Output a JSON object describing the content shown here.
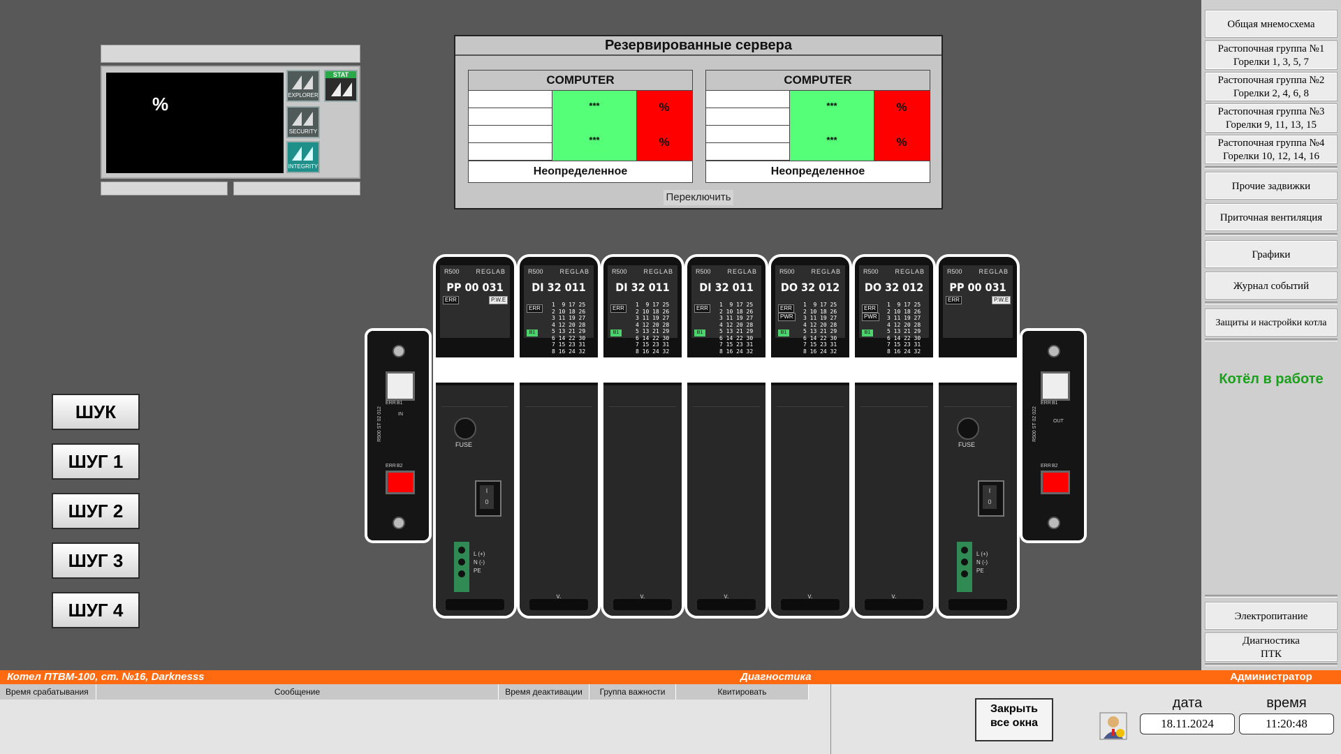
{
  "workstation": {
    "percent_label": "%",
    "buttons": [
      {
        "label": "EXPLORER",
        "icon": "explorer-icon"
      },
      {
        "label": "SECURITY",
        "icon": "security-icon"
      },
      {
        "label": "INTEGRITY",
        "icon": "integrity-icon"
      }
    ],
    "stat_label": "STAT"
  },
  "servers": {
    "title": "Резервированные сервера",
    "computers": [
      {
        "header": "COMPUTER",
        "value1": "***",
        "value2": "***",
        "pct1": "%",
        "pct2": "%",
        "state": "Неопределенное"
      },
      {
        "header": "COMPUTER",
        "value1": "***",
        "value2": "***",
        "pct1": "%",
        "pct2": "%",
        "state": "Неопределенное"
      }
    ],
    "switch_label": "Переключить"
  },
  "cabinets": [
    "ШУК",
    "ШУГ 1",
    "ШУГ 2",
    "ШУГ 3",
    "ШУГ 4"
  ],
  "rack": {
    "brand_series": "R500",
    "brand": "REGLAB",
    "modules": [
      {
        "name": "PP 00 031",
        "type": "power"
      },
      {
        "name": "DI 32 011",
        "type": "io"
      },
      {
        "name": "DI 32 011",
        "type": "io"
      },
      {
        "name": "DI 32 011",
        "type": "io"
      },
      {
        "name": "DO 32 012",
        "type": "io"
      },
      {
        "name": "DO 32 012",
        "type": "io"
      },
      {
        "name": "PP 00 031",
        "type": "power"
      }
    ],
    "pin_rows": [
      "1  9 17 25",
      "2 10 18 26",
      "3 11 19 27",
      "4 12 20 28",
      "5 13 21 29",
      "6 14 22 30",
      "7 15 23 31",
      "8 16 24 32"
    ],
    "labels": {
      "err": "ERR",
      "pwr": "PWR",
      "pwr_top": "P.W.E",
      "b1": "B1",
      "b2": "B2",
      "fuse": "FUSE",
      "toggle_on": "I",
      "toggle_off": "0",
      "l": "L (+)",
      "n": "N (-)",
      "pe": "PE",
      "v": "v.",
      "in": "IN",
      "out": "OUT",
      "endcap_left": "R500 ST 02 012",
      "endcap_right": "R500 ST 02 022"
    }
  },
  "menu": {
    "items_top": [
      {
        "line1": "Общая мнемосхема",
        "line2": ""
      },
      {
        "line1": "Растопочная группа №1",
        "line2": "Горелки 1, 3, 5, 7"
      },
      {
        "line1": "Растопочная группа №2",
        "line2": "Горелки 2, 4, 6, 8"
      },
      {
        "line1": "Растопочная группа №3",
        "line2": "Горелки 9, 11, 13, 15"
      },
      {
        "line1": "Растопочная группа №4",
        "line2": "Горелки 10, 12, 14, 16"
      }
    ],
    "items_mid": [
      "Прочие задвижки",
      "Приточная вентиляция"
    ],
    "items_low": [
      "Графики",
      "Журнал событий"
    ],
    "item_protect": "Защиты и настройки котла",
    "status": "Котёл в работе",
    "items_bottom": [
      {
        "line1": "Электропитание",
        "line2": ""
      },
      {
        "line1": "Диагностика",
        "line2": "ПТК"
      }
    ]
  },
  "status_bar": {
    "object": "Котел ПТВМ-100, ст. №16, Darknesss",
    "screen": "Диагностика",
    "user": "Администратор"
  },
  "alarm_table": {
    "columns": [
      "Время срабатывания",
      "Сообщение",
      "Время деактивации",
      "Группа важности",
      "Квитировать"
    ]
  },
  "footer": {
    "close_line1": "Закрыть",
    "close_line2": "все окна",
    "date_label": "дата",
    "time_label": "время",
    "date": "18.11.2024",
    "time": "11:20:48"
  },
  "colors": {
    "accent_orange": "#ff6a10",
    "ok_green": "#55ff77",
    "alarm_red": "#ff0000",
    "running_green": "#1aa01a"
  }
}
